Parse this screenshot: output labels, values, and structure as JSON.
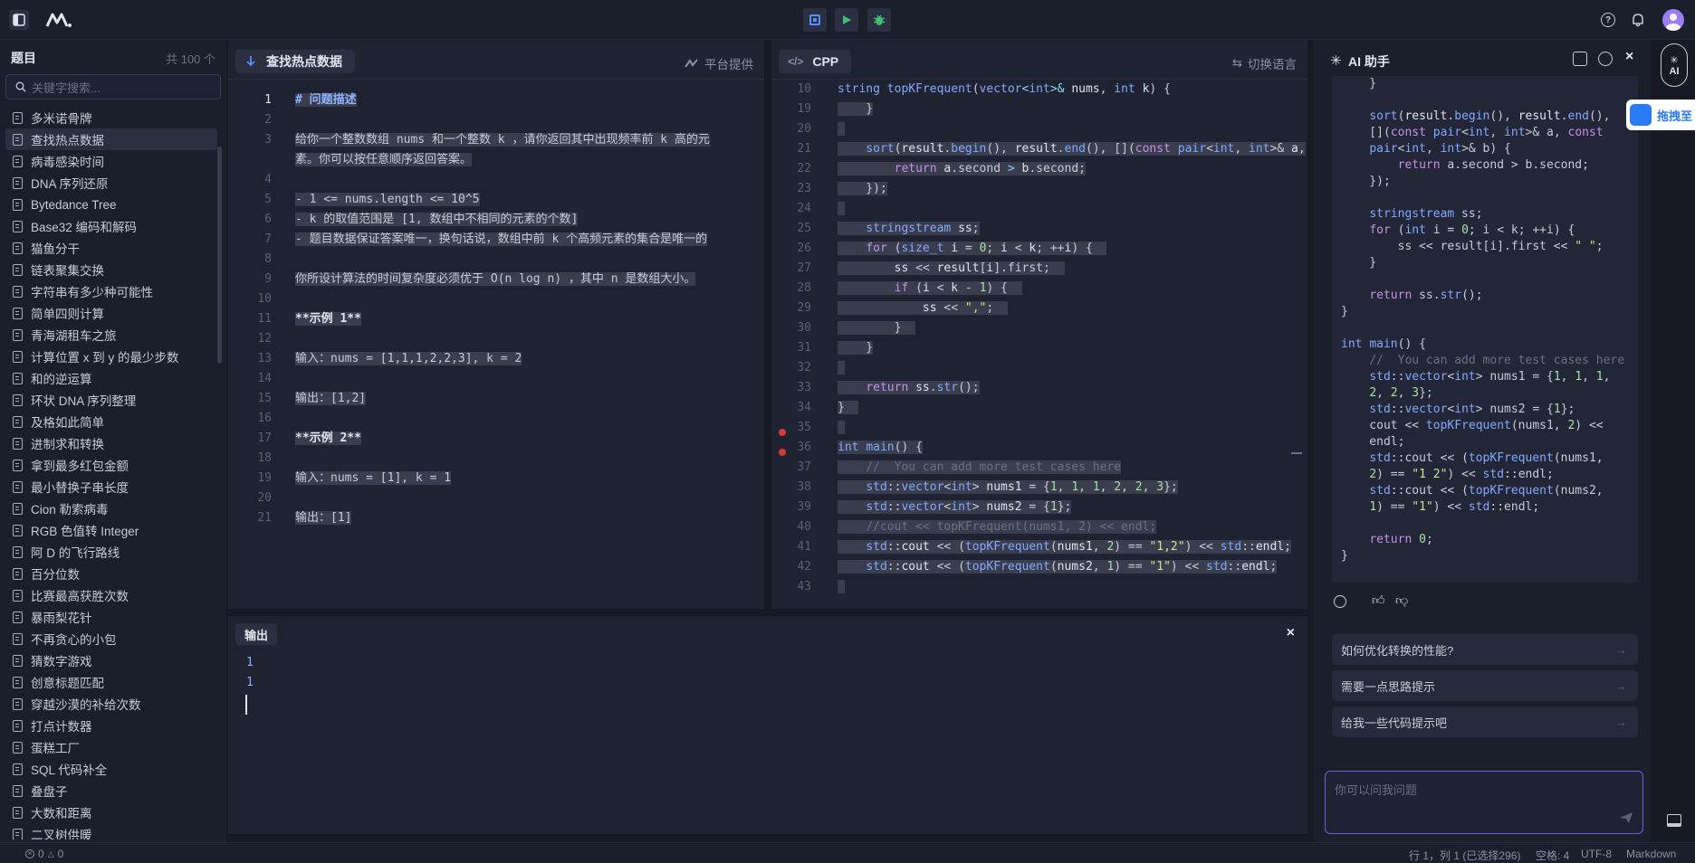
{
  "topbar": {
    "icons": [
      "sidebar-toggle-icon",
      "logo",
      "stop-icon",
      "run-icon",
      "debug-icon",
      "help-icon",
      "bell-icon",
      "avatar"
    ]
  },
  "sidebar": {
    "title": "题目",
    "count": "共 100 个",
    "search_placeholder": "关键字搜索...",
    "items": [
      "多米诺骨牌",
      "查找热点数据",
      "病毒感染时间",
      "DNA 序列还原",
      "Bytedance Tree",
      "Base32 编码和解码",
      "猫鱼分干",
      "链表聚集交换",
      "字符串有多少种可能性",
      "简单四则计算",
      "青海湖租车之旅",
      "计算位置 x 到 y 的最少步数",
      "和的逆运算",
      "环状 DNA 序列整理",
      "及格如此简单",
      "进制求和转换",
      "拿到最多红包金额",
      "最小替换子串长度",
      "Cion 勒索病毒",
      "RGB 色值转 Integer",
      "阿 D 的飞行路线",
      "百分位数",
      "比赛最高获胜次数",
      "暴雨梨花针",
      "不再贪心的小包",
      "猜数字游戏",
      "创意标题匹配",
      "穿越沙漠的补给次数",
      "打点计数器",
      "蛋糕工厂",
      "SQL 代码补全",
      "叠盘子",
      "大数和距离",
      "二叉树供暖"
    ]
  },
  "problem": {
    "tab": "查找热点数据",
    "provider": "平台提供",
    "line_numbers": [
      "1",
      "2",
      "3",
      "",
      "4",
      "5",
      "6",
      "7",
      "8",
      "9",
      "10",
      "11",
      "12",
      "13",
      "14",
      "15",
      "16",
      "17",
      "18",
      "19",
      "20",
      "21"
    ],
    "lines": [
      "# 问题描述",
      "",
      "给你一个整数数组 nums 和一个整数 k ，请你返回其中出现频率前 k 高的元",
      "素。你可以按任意顺序返回答案。",
      "",
      "- 1 <= nums.length <= 10^5",
      "- k 的取值范围是 [1, 数组中不相同的元素的个数]",
      "- 题目数据保证答案唯一，换句话说，数组中前 k 个高频元素的集合是唯一的",
      "",
      "你所设计算法的时间复杂度必须优于 O(n log n) ，其中 n 是数组大小。",
      "",
      "**示例 1**",
      "",
      "输入：nums = [1,1,1,2,2,3], k = 2",
      "",
      "输出：[1,2]",
      "",
      "**示例 2**",
      "",
      "输入：nums = [1], k = 1",
      "",
      "输出：[1]"
    ]
  },
  "editor": {
    "lang": "CPP",
    "switch_label": "切换语言",
    "line_numbers": [
      "10",
      "19",
      "20",
      "21",
      "22",
      "23",
      "24",
      "25",
      "26",
      "27",
      "28",
      "29",
      "30",
      "31",
      "32",
      "33",
      "34",
      "35",
      "36",
      "37",
      "38",
      "39",
      "40",
      "41",
      "42",
      "43"
    ],
    "first_line": "string topKFrequent(vector<int>& nums, int k) {"
  },
  "output": {
    "title": "输出",
    "lines": [
      "1",
      "1"
    ]
  },
  "ai": {
    "title": "AI 助手",
    "suggestions": [
      "如何优化转换的性能?",
      "需要一点思路提示",
      "给我一些代码提示吧"
    ],
    "input_placeholder": "你可以问我问题",
    "badge": "AI",
    "float_label": "拖拽至"
  },
  "status": {
    "problems": "0",
    "warnings": "0",
    "position": "行 1，列 1 (已选择296)",
    "spaces": "空格: 4",
    "encoding": "UTF-8",
    "language": "Markdown"
  }
}
